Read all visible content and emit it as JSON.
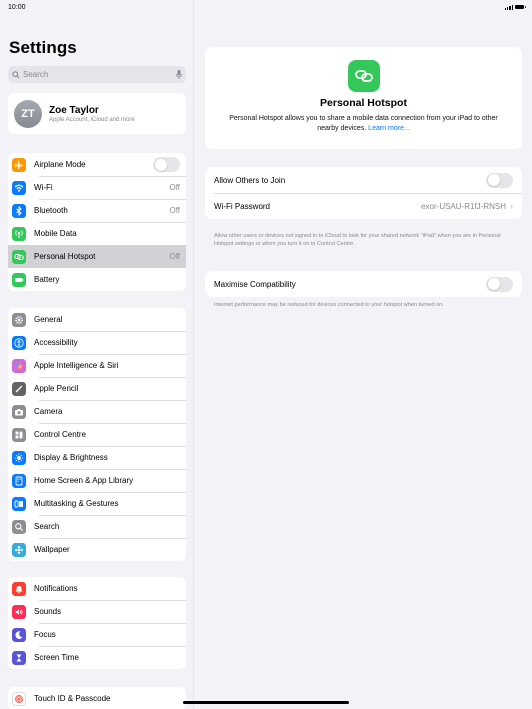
{
  "status_bar": {
    "time": "10:00"
  },
  "sidebar": {
    "title": "Settings",
    "search_placeholder": "Search",
    "profile": {
      "initials": "ZT",
      "name": "Zoe Taylor",
      "subtitle": "Apple Account, iCloud and more"
    },
    "groups": [
      [
        {
          "label": "Airplane Mode",
          "icon": "airplane-icon",
          "color": "#ff9500",
          "toggle": "off"
        },
        {
          "label": "Wi-Fi",
          "icon": "wifi-icon",
          "color": "#0a7aff",
          "value": "Off"
        },
        {
          "label": "Bluetooth",
          "icon": "bluetooth-icon",
          "color": "#0a7aff",
          "value": "Off"
        },
        {
          "label": "Mobile Data",
          "icon": "antenna-icon",
          "color": "#34c759"
        },
        {
          "label": "Personal Hotspot",
          "icon": "hotspot-link-icon",
          "color": "#34c759",
          "value": "Off",
          "selected": true
        },
        {
          "label": "Battery",
          "icon": "battery-icon",
          "color": "#34c759"
        }
      ],
      [
        {
          "label": "General",
          "icon": "gear-icon",
          "color": "#8e8e93"
        },
        {
          "label": "Accessibility",
          "icon": "accessibility-icon",
          "color": "#0a7aff"
        },
        {
          "label": "Apple Intelligence & Siri",
          "icon": "siri-icon",
          "color": "#c86dd7"
        },
        {
          "label": "Apple Pencil",
          "icon": "pencil-icon",
          "color": "#636366"
        },
        {
          "label": "Camera",
          "icon": "camera-icon",
          "color": "#8e8e93"
        },
        {
          "label": "Control Centre",
          "icon": "control-centre-icon",
          "color": "#8e8e93"
        },
        {
          "label": "Display & Brightness",
          "icon": "sun-icon",
          "color": "#0a7aff"
        },
        {
          "label": "Home Screen & App Library",
          "icon": "home-screen-icon",
          "color": "#0a7aff"
        },
        {
          "label": "Multitasking & Gestures",
          "icon": "multitasking-icon",
          "color": "#0a7aff"
        },
        {
          "label": "Search",
          "icon": "search-icon",
          "color": "#8e8e93"
        },
        {
          "label": "Wallpaper",
          "icon": "wallpaper-icon",
          "color": "#35aadc"
        }
      ],
      [
        {
          "label": "Notifications",
          "icon": "bell-icon",
          "color": "#ff3b30"
        },
        {
          "label": "Sounds",
          "icon": "speaker-icon",
          "color": "#ff2d55"
        },
        {
          "label": "Focus",
          "icon": "moon-icon",
          "color": "#5856d6"
        },
        {
          "label": "Screen Time",
          "icon": "hourglass-icon",
          "color": "#5856d6"
        }
      ],
      [
        {
          "label": "Touch ID & Passcode",
          "icon": "fingerprint-icon",
          "color": "#ffffff"
        }
      ]
    ]
  },
  "detail": {
    "hero": {
      "title": "Personal Hotspot",
      "description": "Personal Hotspot allows you to share a mobile data connection from your iPad to other nearby devices.",
      "link": "Learn more..."
    },
    "allow_others": {
      "label": "Allow Others to Join",
      "toggle": "off"
    },
    "wifi_password": {
      "label": "Wi-Fi Password",
      "value": "exor-USAU-R1fJ-RNSH"
    },
    "note1": "Allow other users or devices not signed in to iCloud to look for your shared network \"iPad\" when you are in Personal Hotspot settings or when you turn it on in Control Centre.",
    "maximise": {
      "label": "Maximise Compatibility",
      "toggle": "off"
    },
    "note2": "Internet performance may be reduced for devices connected to your hotspot when turned on.",
    "accent_color": "#34c759",
    "link_color": "#0a7aff"
  }
}
